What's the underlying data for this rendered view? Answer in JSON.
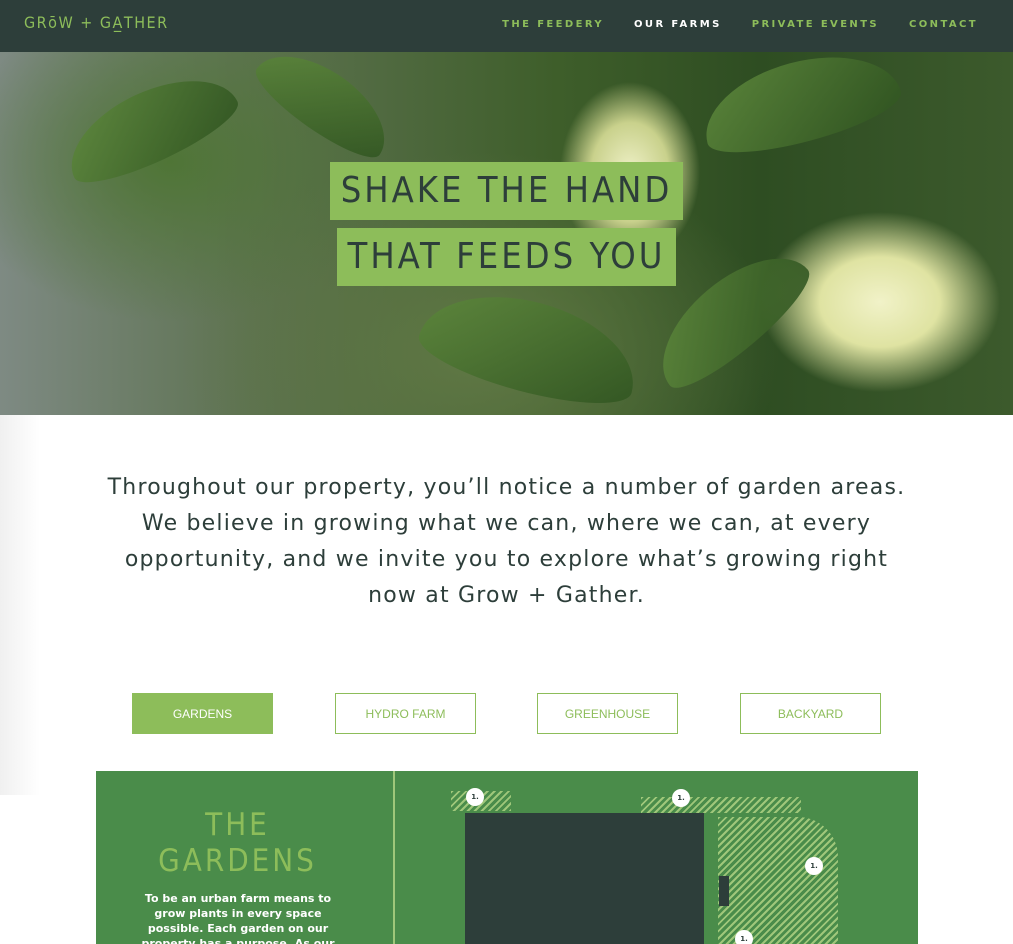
{
  "brand": {
    "logo_text": "GRōW + GA̲THER"
  },
  "nav": {
    "items": [
      {
        "label": "THE FEEDERY",
        "active": false
      },
      {
        "label": "OUR FARMS",
        "active": true
      },
      {
        "label": "PRIVATE EVENTS",
        "active": false
      },
      {
        "label": "CONTACT",
        "active": false
      }
    ]
  },
  "hero": {
    "line1": "SHAKE THE HAND",
    "line2": "THAT FEEDS YOU"
  },
  "intro": {
    "text": "Throughout our property, you’ll notice a number of garden areas. We believe in growing what we can, where we can, at every opportunity, and we invite you to explore what’s growing right now at Grow + Gather."
  },
  "tabs": [
    {
      "label": "GARDENS",
      "active": true
    },
    {
      "label": "HYDRO FARM",
      "active": false
    },
    {
      "label": "GREENHOUSE",
      "active": false
    },
    {
      "label": "BACKYARD",
      "active": false
    }
  ],
  "panel": {
    "title_line1": "THE",
    "title_line2": "GARDENS",
    "text": "To be an urban farm means to grow plants in every space possible. Each garden on our property has a purpose. As our green roof helps to",
    "markers": [
      "1.",
      "1.",
      "1.",
      "1."
    ]
  },
  "colors": {
    "nav_bg": "#2d3e3a",
    "accent": "#8dbd5a",
    "panel_bg": "#4a8c4a",
    "text": "#2d3e3a"
  }
}
